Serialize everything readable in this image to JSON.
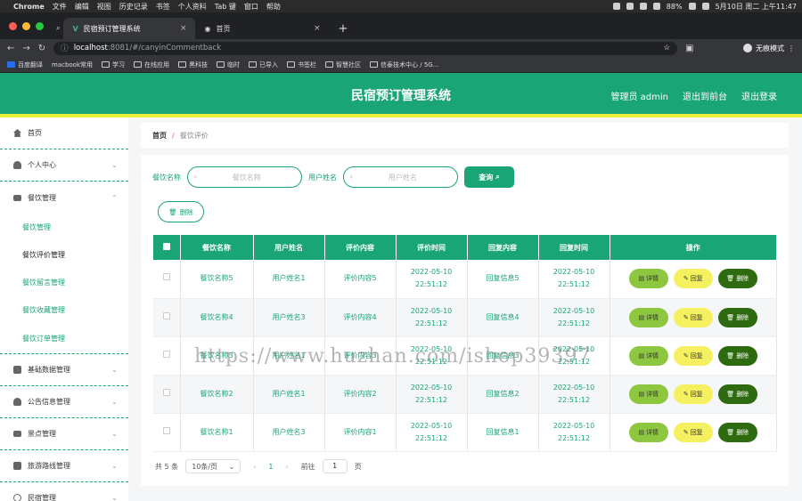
{
  "os_bar": {
    "apple": "",
    "app": "Chrome",
    "menus": [
      "文件",
      "编辑",
      "视图",
      "历史记录",
      "书签",
      "个人资料",
      "Tab 键",
      "窗口",
      "帮助"
    ],
    "battery": "88%",
    "clock": "5月10日 周二 上午11:47"
  },
  "browser": {
    "tabs": [
      {
        "title": "民宿预订管理系统",
        "active": true
      },
      {
        "title": "首页",
        "active": false
      }
    ],
    "new_tab": "+",
    "url_host": "localhost",
    "url_rest": ":8081/#/canyinCommentback",
    "profile": "无痕模式",
    "bookmarks": [
      "百度翻译",
      "macbook常用",
      "学习",
      "在线应用",
      "黑科技",
      "临时",
      "已导入",
      "书签栏",
      "智慧社区",
      "信泰技术中心 / 5G..."
    ]
  },
  "header": {
    "title": "民宿预订管理系统",
    "links": [
      "管理员 admin",
      "退出到前台",
      "退出登录"
    ]
  },
  "sidebar": {
    "items": [
      {
        "label": "首页",
        "icon": "home-icon",
        "chev": ""
      },
      {
        "label": "个人中心",
        "icon": "user-icon",
        "chev": "⌄"
      },
      {
        "label": "餐饮管理",
        "icon": "sliders-icon",
        "chev": "⌃"
      }
    ],
    "sub": [
      "餐饮管理",
      "餐饮评价管理",
      "餐饮留言管理",
      "餐饮收藏管理",
      "餐饮订单管理"
    ],
    "more": [
      {
        "label": "基础数据管理",
        "icon": "clipboard-icon"
      },
      {
        "label": "公告信息管理",
        "icon": "person-icon"
      },
      {
        "label": "景点管理",
        "icon": "ticket-icon"
      },
      {
        "label": "旅游路线管理",
        "icon": "grid-icon"
      },
      {
        "label": "民宿管理",
        "icon": "power-icon"
      }
    ]
  },
  "breadcrumb": {
    "home": "首页",
    "sep": "/",
    "current": "餐饮评价"
  },
  "search": {
    "label1": "餐饮名称",
    "placeholder1": "餐饮名称",
    "label2": "用户姓名",
    "placeholder2": "用户姓名",
    "query": "查询"
  },
  "bulk_delete": "删除",
  "table": {
    "headers": [
      "餐饮名称",
      "用户姓名",
      "评价内容",
      "评价时间",
      "回复内容",
      "回复时间",
      "操作"
    ],
    "rows": [
      {
        "name": "餐饮名称5",
        "user": "用户姓名1",
        "content": "评价内容5",
        "time": "2022-05-10 22:51:12",
        "reply": "回复信息5",
        "rtime": "2022-05-10 22:51:12"
      },
      {
        "name": "餐饮名称4",
        "user": "用户姓名3",
        "content": "评价内容4",
        "time": "2022-05-10 22:51:12",
        "reply": "回复信息4",
        "rtime": "2022-05-10 22:51:12"
      },
      {
        "name": "餐饮名称3",
        "user": "用户姓名1",
        "content": "评价内容3",
        "time": "2022-05-10 22:51:12",
        "reply": "回复信息3",
        "rtime": "2022-05-10 22:51:12"
      },
      {
        "name": "餐饮名称2",
        "user": "用户姓名1",
        "content": "评价内容2",
        "time": "2022-05-10 22:51:12",
        "reply": "回复信息2",
        "rtime": "2022-05-10 22:51:12"
      },
      {
        "name": "餐饮名称1",
        "user": "用户姓名3",
        "content": "评价内容1",
        "time": "2022-05-10 22:51:12",
        "reply": "回复信息1",
        "rtime": "2022-05-10 22:51:12"
      }
    ],
    "actions": {
      "detail": "详情",
      "reply": "回复",
      "delete": "删除"
    }
  },
  "pager": {
    "total": "共 5 条",
    "size": "10条/页",
    "prev": "‹",
    "page": "1",
    "next": "›",
    "goto": "前往",
    "goto_value": "1",
    "unit": "页"
  },
  "watermark": "https://www.huzhan.com/ishop39397",
  "colors": {
    "primary": "#1aa577",
    "accent_line": "#e9f03a",
    "detail": "#8dc63f",
    "reply": "#f5f060",
    "delete": "#2e6a10"
  }
}
